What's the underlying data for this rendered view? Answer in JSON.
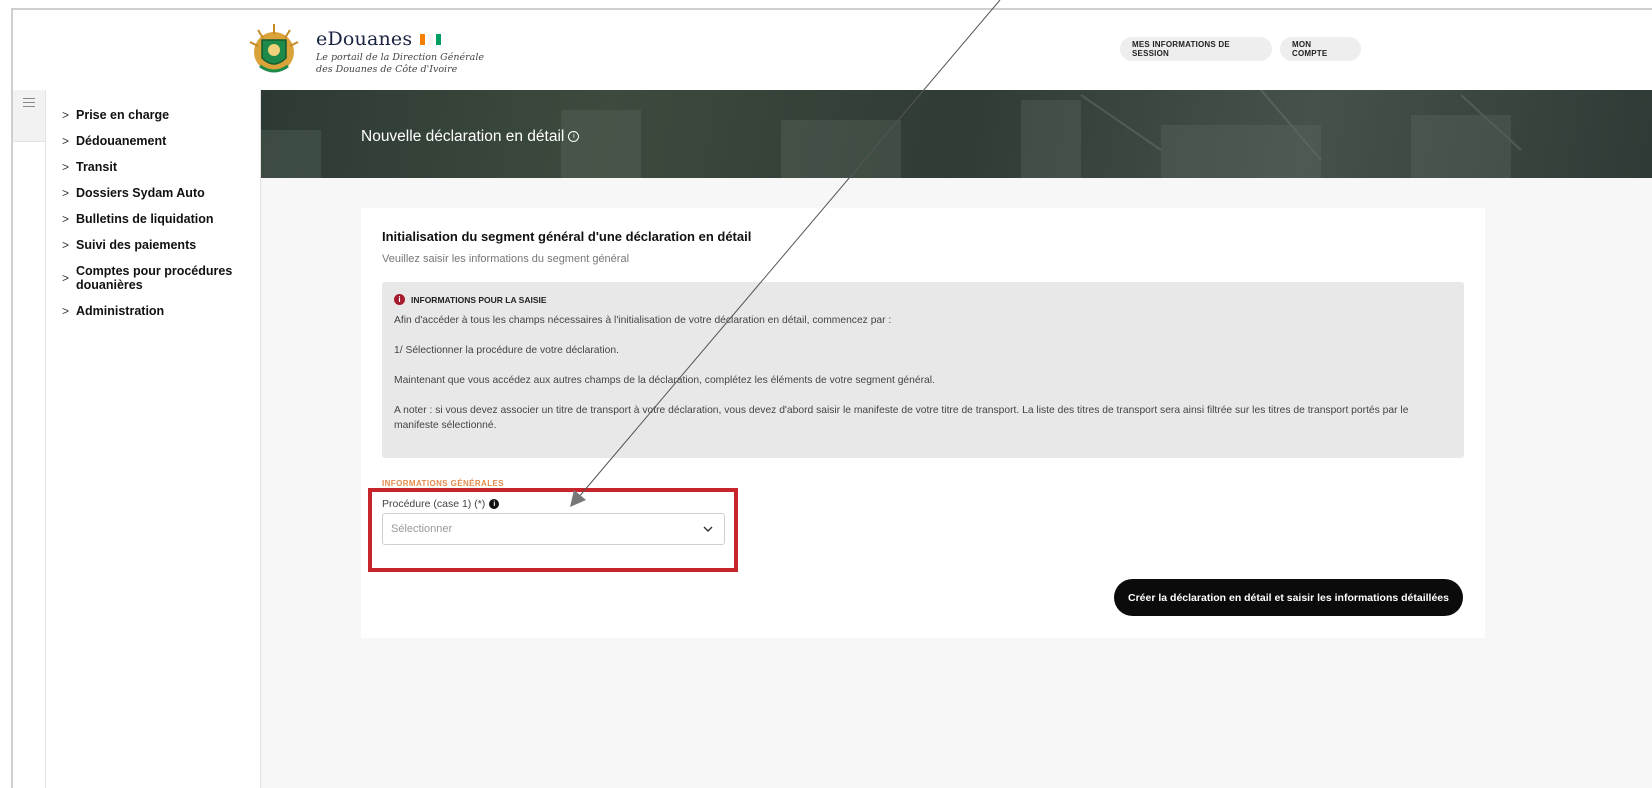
{
  "header": {
    "brand_title": "eDouanes",
    "brand_subtitle_line1": "Le portail de la Direction Générale",
    "brand_subtitle_line2": "des Douanes de Côte d'Ivoire",
    "session_button": "MES INFORMATIONS DE SESSION",
    "account_button": "MON COMPTE",
    "flag_colors": [
      "#f77f00",
      "#ffffff",
      "#009e60"
    ]
  },
  "sidebar": {
    "items": [
      {
        "label": "Prise en charge"
      },
      {
        "label": "Dédouanement"
      },
      {
        "label": "Transit"
      },
      {
        "label": "Dossiers Sydam Auto"
      },
      {
        "label": "Bulletins de liquidation"
      },
      {
        "label": "Suivi des paiements"
      },
      {
        "label": "Comptes pour procédures douanières"
      },
      {
        "label": "Administration"
      }
    ]
  },
  "banner": {
    "title": "Nouvelle déclaration en détail"
  },
  "card": {
    "title": "Initialisation du segment général d'une déclaration en détail",
    "subtitle": "Veuillez saisir les informations du segment général",
    "info_heading": "INFORMATIONS POUR LA SAISIE",
    "info_lines": [
      "Afin d'accéder à tous les champs nécessaires à l'initialisation de votre déclaration en détail, commencez par :",
      "1/ Sélectionner la procédure de votre déclaration.",
      "Maintenant que vous accédez aux autres champs de la déclaration, complétez les éléments de votre segment général.",
      "A noter : si vous devez associer un titre de transport à votre déclaration, vous devez d'abord saisir le manifeste de votre titre de transport. La liste des titres de transport sera ainsi filtrée sur les titres de transport portés par le manifeste sélectionné."
    ],
    "section_label": "INFORMATIONS GÉNÉRALES",
    "procedure_label": "Procédure (case 1) (*)",
    "procedure_placeholder": "Sélectionner",
    "create_button": "Créer la déclaration en détail et saisir les informations détaillées"
  },
  "colors": {
    "highlight_border": "#c8242b",
    "info_icon": "#a51c2c",
    "section_label": "#e38a4c",
    "primary_button": "#0b0b0b"
  }
}
